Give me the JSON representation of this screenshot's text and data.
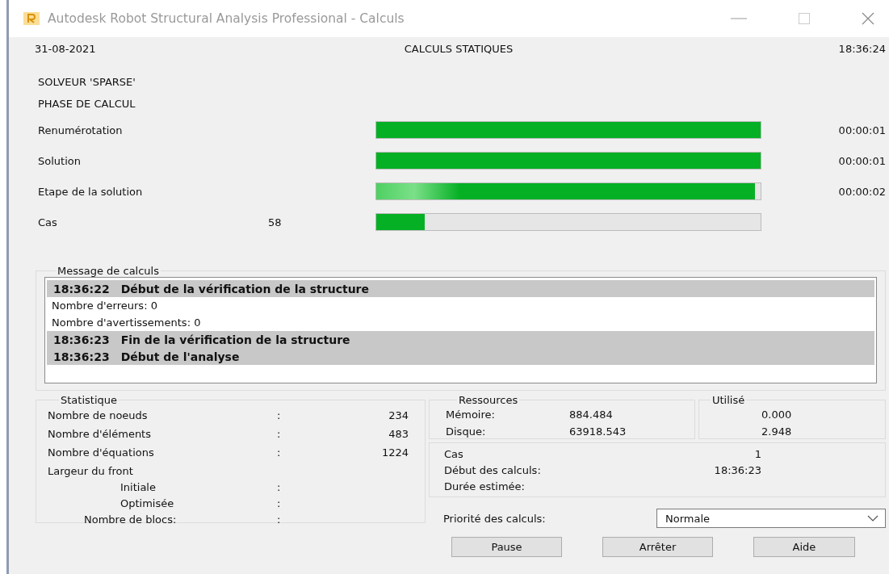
{
  "window": {
    "title": "Autodesk Robot Structural Analysis Professional - Calculs"
  },
  "header": {
    "date": "31-08-2021",
    "title": "CALCULS STATIQUES",
    "time": "18:36:24"
  },
  "solver": "SOLVEUR 'SPARSE'",
  "phase": "PHASE DE CALCUL",
  "progress": [
    {
      "label": "Renumérotation",
      "level": 1,
      "time": "00:00:01"
    },
    {
      "label": "Solution",
      "level": 1,
      "time": "00:00:01"
    },
    {
      "label": "Etape de la solution",
      "level": 0.985,
      "time": "00:00:02"
    },
    {
      "label": "Cas",
      "count": "58",
      "level": 0.125
    }
  ],
  "messages": {
    "title": "Message de calculs",
    "lines": [
      {
        "kind": "event",
        "time": "18:36:22",
        "text": "Début de la vérification de la structure"
      },
      {
        "kind": "detail",
        "text": "Nombre d'erreurs: 0"
      },
      {
        "kind": "detail",
        "text": "Nombre d'avertissements: 0"
      },
      {
        "kind": "event",
        "time": "18:36:23",
        "text": "Fin de la vérification de la structure"
      },
      {
        "kind": "event",
        "time": "18:36:23",
        "text": "Début de l'analyse"
      }
    ]
  },
  "statistics": {
    "title": "Statistique",
    "rows": [
      {
        "kind": "main",
        "label": "Nombre de noeuds",
        "separator": ":",
        "value": "234"
      },
      {
        "kind": "main",
        "label": "Nombre d'éléments",
        "separator": ":",
        "value": "483"
      },
      {
        "kind": "main",
        "label": "Nombre d'équations",
        "separator": ":",
        "value": "1224"
      },
      {
        "kind": "main",
        "label": "Largeur du front"
      },
      {
        "kind": "sub",
        "label": "Initiale",
        "separator": ":"
      },
      {
        "kind": "sub",
        "label": "Optimisée",
        "separator": ":"
      },
      {
        "kind": "mid",
        "label": "Nombre de blocs:",
        "separator": ":"
      }
    ]
  },
  "resources": {
    "title": "Ressources",
    "rows": [
      {
        "label": "Mémoire:",
        "value": "884.484"
      },
      {
        "label": "Disque:",
        "value": "63918.543"
      }
    ]
  },
  "used": {
    "title": "Utilisé",
    "values": [
      "0.000",
      "2.948"
    ]
  },
  "case_info": [
    {
      "label": "Cas",
      "value": "1"
    },
    {
      "label": "Début des calculs:",
      "value": "18:36:23"
    },
    {
      "label": "Durée estimée:"
    }
  ],
  "priority": {
    "label": "Priorité des calculs:",
    "value": "Normale"
  },
  "buttons": [
    "Pause",
    "Arrêter",
    "Aide"
  ]
}
